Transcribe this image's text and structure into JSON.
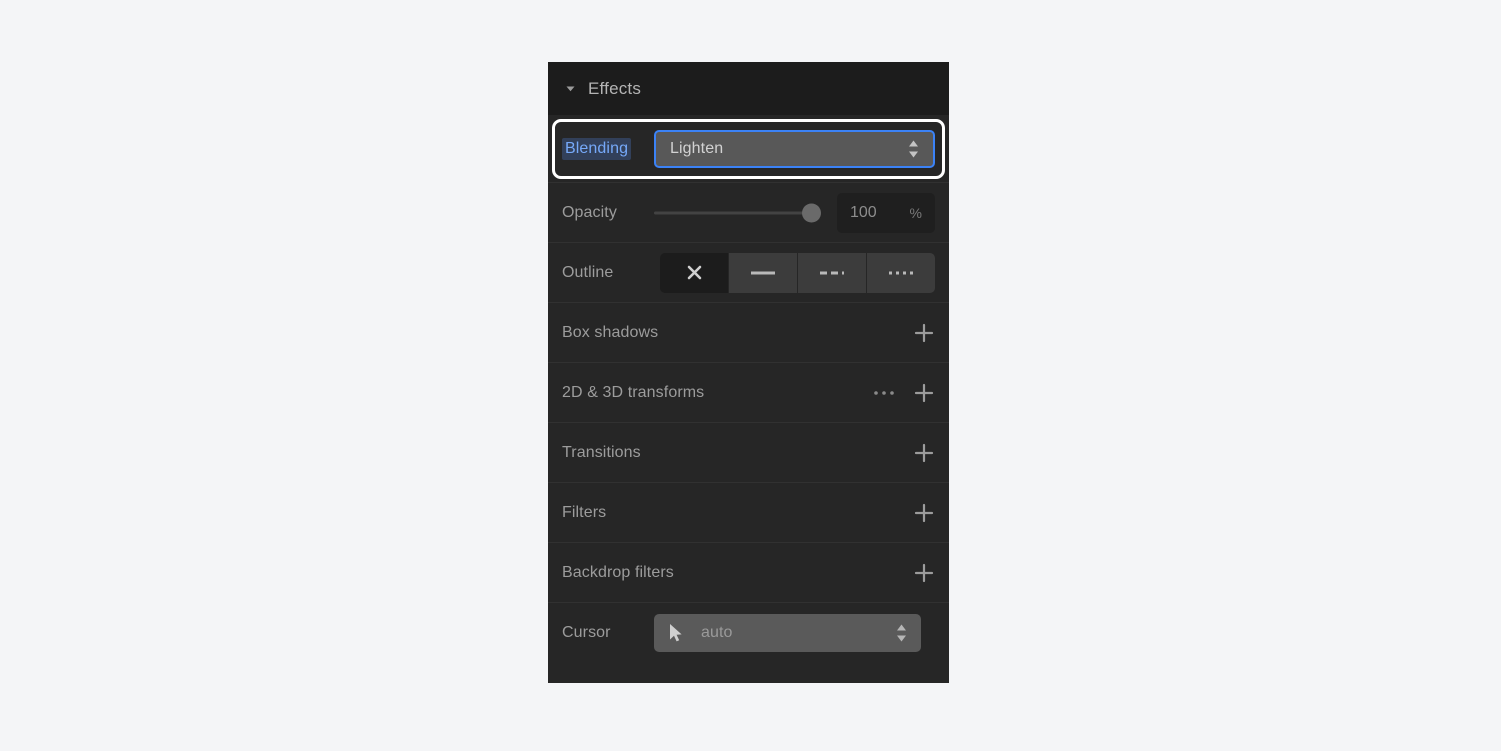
{
  "panel": {
    "header": {
      "title": "Effects",
      "disclosure_icon": "triangle-down-icon",
      "expanded": true
    },
    "blending": {
      "label": "Blending",
      "value": "Lighten",
      "stepper_icon": "stepper-updown-icon",
      "focused": true,
      "highlight_color": "#ffffff",
      "label_text_color": "#76a9f9",
      "label_bg_color": "#32405a",
      "select_border_color": "#3b82f6"
    },
    "opacity": {
      "label": "Opacity",
      "value": "100",
      "unit": "%",
      "slider_percent": 100
    },
    "outline": {
      "label": "Outline",
      "options": [
        {
          "name": "none",
          "icon": "close-x-icon",
          "selected": true
        },
        {
          "name": "solid",
          "icon": "line-solid-icon",
          "selected": false
        },
        {
          "name": "dashed",
          "icon": "line-dashed-icon",
          "selected": false
        },
        {
          "name": "dotted",
          "icon": "line-dotted-icon",
          "selected": false
        }
      ]
    },
    "list_rows": [
      {
        "label": "Box shadows",
        "has_more": false,
        "add_icon": "plus-icon",
        "more_icon": "ellipsis-icon"
      },
      {
        "label": "2D & 3D transforms",
        "has_more": true,
        "add_icon": "plus-icon",
        "more_icon": "ellipsis-icon"
      },
      {
        "label": "Transitions",
        "has_more": false,
        "add_icon": "plus-icon",
        "more_icon": "ellipsis-icon"
      },
      {
        "label": "Filters",
        "has_more": false,
        "add_icon": "plus-icon",
        "more_icon": "ellipsis-icon"
      },
      {
        "label": "Backdrop filters",
        "has_more": false,
        "add_icon": "plus-icon",
        "more_icon": "ellipsis-icon"
      }
    ],
    "cursor": {
      "label": "Cursor",
      "value": "auto",
      "glyph_icon": "mouse-pointer-icon",
      "stepper_icon": "stepper-updown-icon"
    }
  }
}
